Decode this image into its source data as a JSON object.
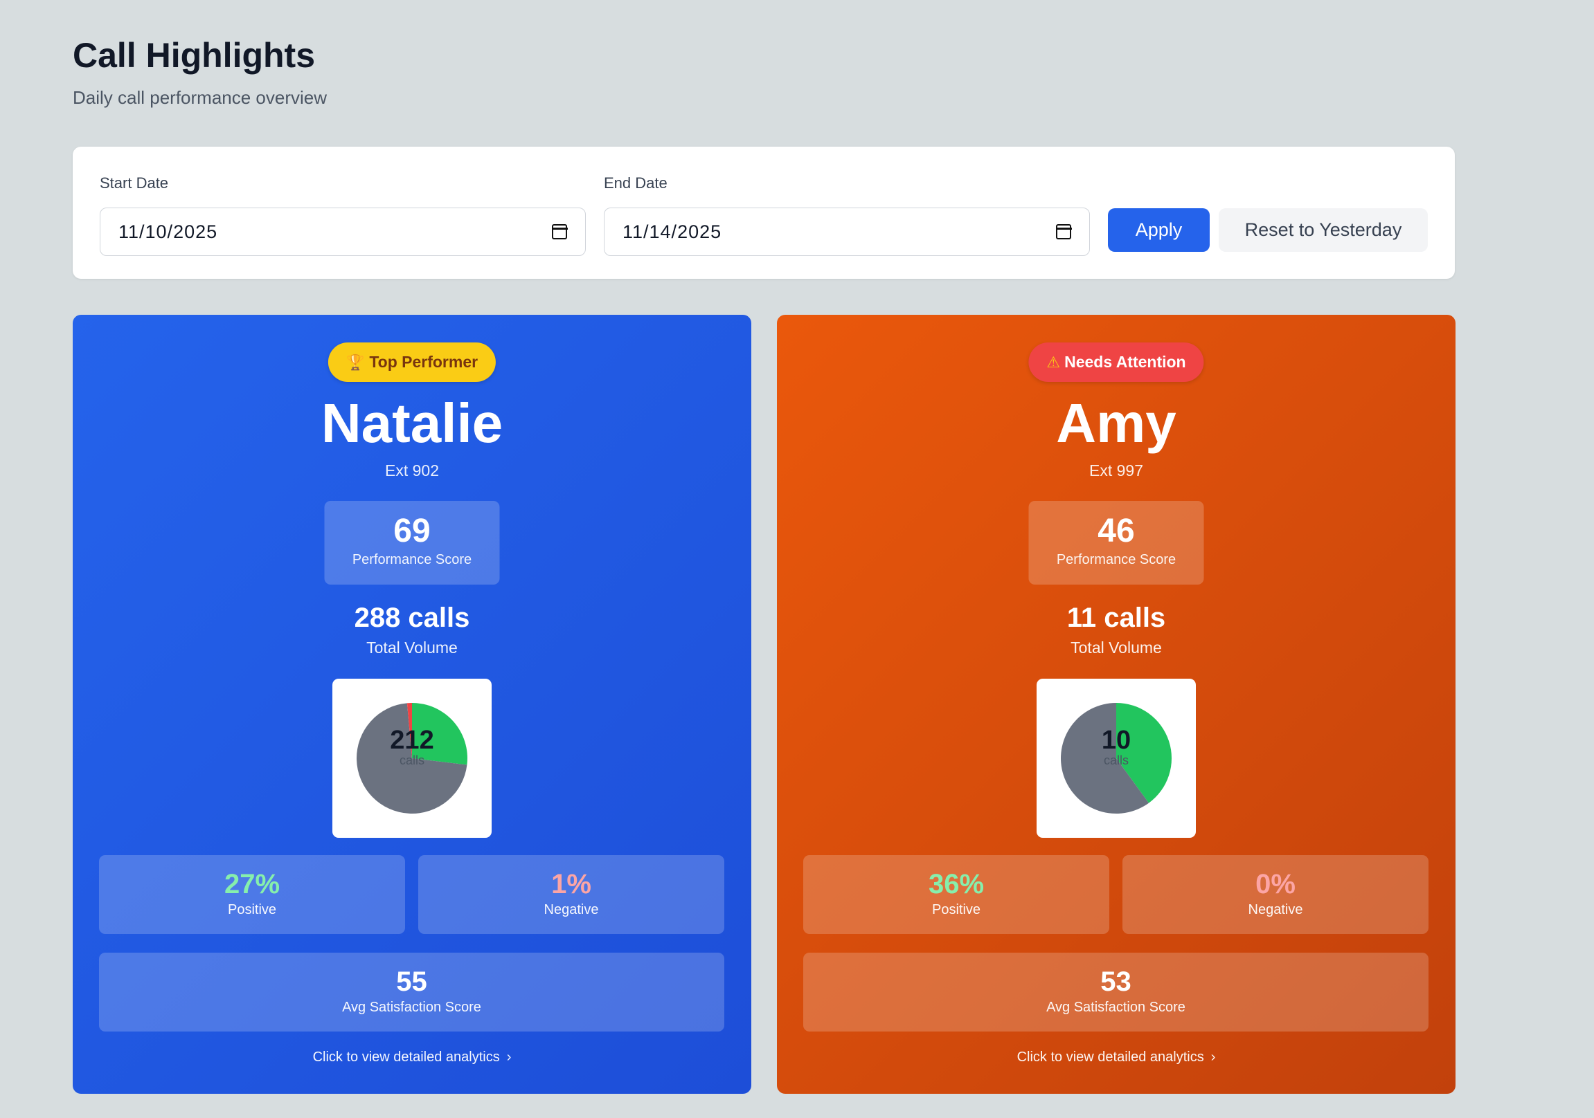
{
  "header": {
    "title": "Call Highlights",
    "subtitle": "Daily call performance overview"
  },
  "filters": {
    "start_label": "Start Date",
    "start_value": "11/10/2025",
    "end_label": "End Date",
    "end_value": "11/14/2025",
    "apply_label": "Apply",
    "reset_label": "Reset to Yesterday",
    "calendar_icon": "calendar-icon"
  },
  "cards": [
    {
      "badge_icon": "trophy-icon",
      "badge_glyph": "🏆",
      "badge": "Top Performer",
      "name": "Natalie",
      "ext": "Ext 902",
      "score": "69",
      "score_label": "Performance Score",
      "calls": "288 calls",
      "volume_label": "Total Volume",
      "pie_total": "212",
      "pie_unit": "calls",
      "pie": {
        "positive": 57,
        "neutral": 152,
        "negative": 3
      },
      "positive": "27%",
      "positive_label": "Positive",
      "negative": "1%",
      "negative_label": "Negative",
      "satisfaction": "55",
      "satisfaction_label": "Avg Satisfaction Score",
      "link": "Click to view detailed analytics",
      "accent": "#2563eb"
    },
    {
      "badge_icon": "warning-icon",
      "badge_glyph": "⚠",
      "badge": "Needs Attention",
      "name": "Amy",
      "ext": "Ext 997",
      "score": "46",
      "score_label": "Performance Score",
      "calls": "11 calls",
      "volume_label": "Total Volume",
      "pie_total": "10",
      "pie_unit": "calls",
      "pie": {
        "positive": 4,
        "neutral": 6,
        "negative": 0
      },
      "positive": "36%",
      "positive_label": "Positive",
      "negative": "0%",
      "negative_label": "Negative",
      "satisfaction": "53",
      "satisfaction_label": "Avg Satisfaction Score",
      "link": "Click to view detailed analytics",
      "accent": "#ea580c"
    }
  ],
  "colors": {
    "positive": "#22c55e",
    "neutral": "#6b7280",
    "negative": "#ef4444"
  }
}
